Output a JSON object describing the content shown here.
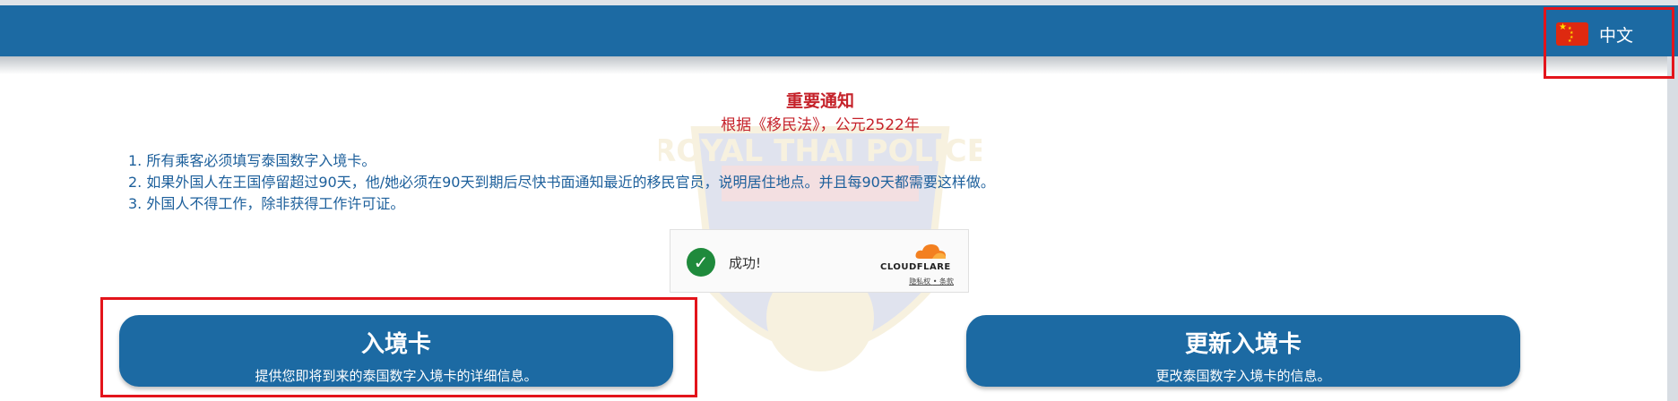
{
  "header": {
    "language": {
      "label": "中文",
      "flag_icon": "china-flag-icon"
    },
    "color": "#1c6aa3"
  },
  "notice": {
    "title": "重要通知",
    "subtitle": "根据《移民法》，公元2522年",
    "items": [
      "1. 所有乘客必须填写泰国数字入境卡。",
      "2. 如果外国人在王国停留超过90天，他/她必须在90天到期后尽快书面通知最近的移民官员，说明居住地点。并且每90天都需要这样做。",
      "3. 外国人不得工作，除非获得工作许可证。"
    ]
  },
  "background_emblem": {
    "text": "ROYAL THAI POLICE"
  },
  "captcha": {
    "status": "成功!",
    "brand": "CLOUDFLARE",
    "links": [
      "隐私权",
      "条款"
    ],
    "link_separator": "•"
  },
  "actions": {
    "arrival_card": {
      "title": "入境卡",
      "description": "提供您即将到来的泰国数字入境卡的详细信息。"
    },
    "update_card": {
      "title": "更新入境卡",
      "description": "更改泰国数字入境卡的信息。"
    }
  },
  "colors": {
    "accent": "#1c6aa3",
    "notice_red": "#c5222a",
    "highlight": "#e3141b",
    "success": "#1f8a3c"
  }
}
